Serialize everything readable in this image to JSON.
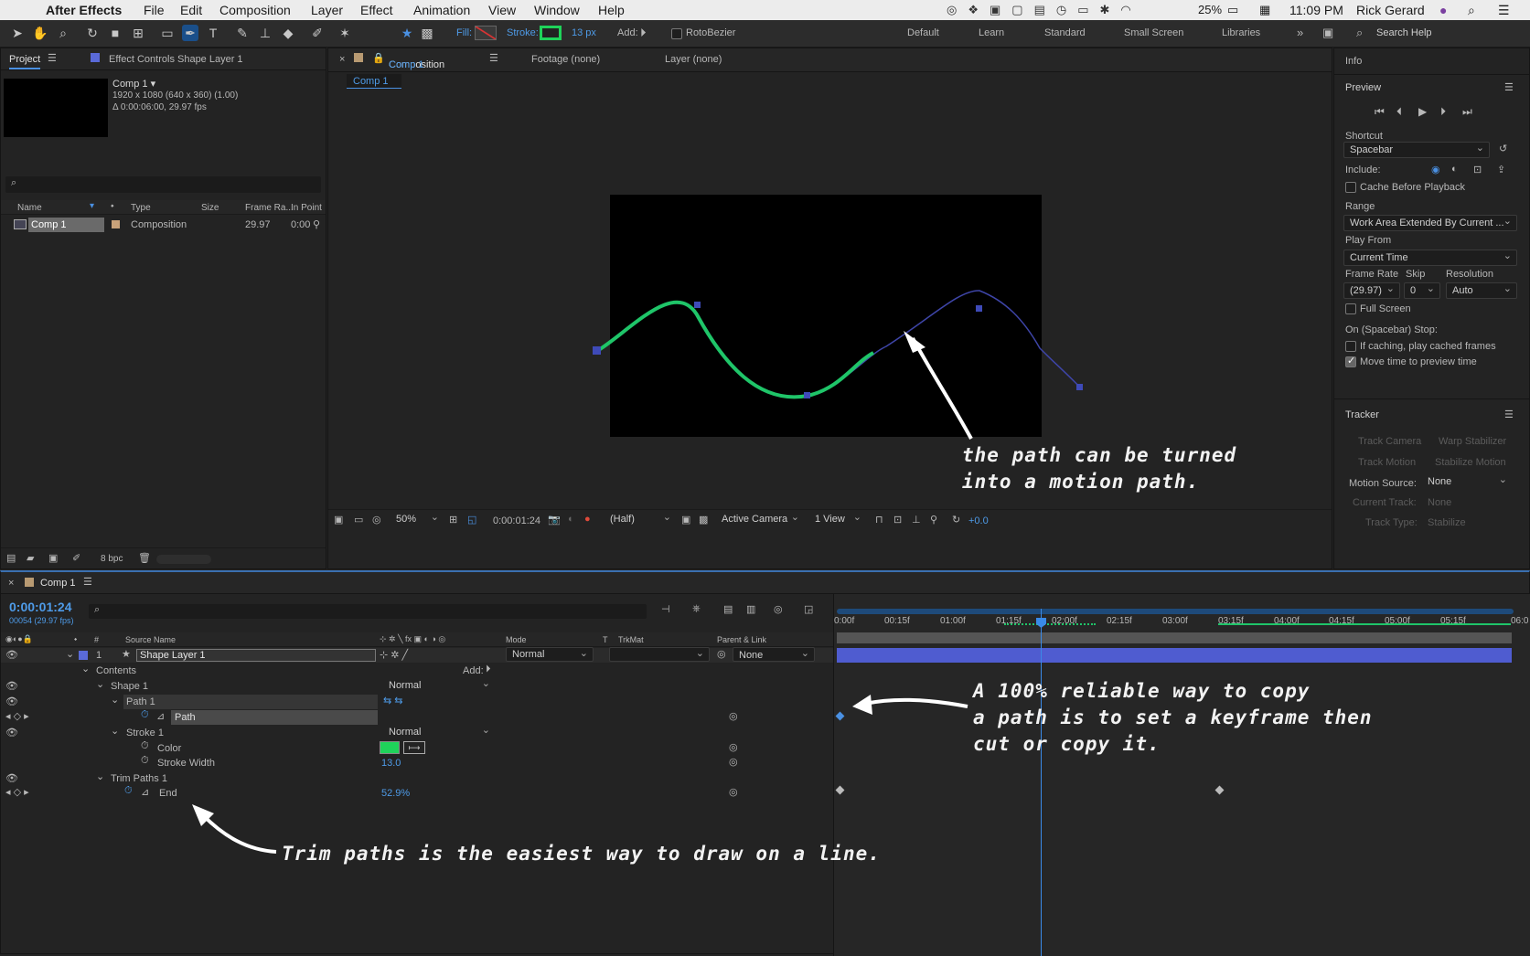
{
  "menubar": {
    "app": "After Effects",
    "items": [
      "File",
      "Edit",
      "Composition",
      "Layer",
      "Effect",
      "Animation",
      "View",
      "Window",
      "Help"
    ],
    "battery": "25%",
    "time": "11:09 PM",
    "user": "Rick Gerard"
  },
  "toolbar": {
    "fill_label": "Fill:",
    "stroke_label": "Stroke:",
    "stroke_width": "13 px",
    "add_label": "Add:",
    "rotobezier": "RotoBezier",
    "workspaces": [
      "Default",
      "Learn",
      "Standard",
      "Small Screen",
      "Libraries"
    ],
    "search_help": "Search Help",
    "stroke_color": "#1fd35a"
  },
  "project": {
    "tab": "Project",
    "effect_controls": "Effect Controls Shape Layer 1",
    "comp_name": "Comp 1 ▾",
    "comp_size": "1920 x 1080  (640 x 360) (1.00)",
    "comp_duration": "Δ 0:00:06:00, 29.97 fps",
    "columns": [
      "Name",
      "Type",
      "Size",
      "Frame Ra...",
      "In Point"
    ],
    "row": {
      "name": "Comp 1",
      "type": "Composition",
      "fps": "29.97",
      "in": "0:00"
    },
    "bpc": "8 bpc"
  },
  "viewer": {
    "tab_comp_prefix": "Composition",
    "tab_comp_name": "Comp 1",
    "tab_footage": "Footage (none)",
    "tab_layer": "Layer (none)",
    "subtab": "Comp 1",
    "zoom": "50%",
    "timecode": "0:00:01:24",
    "resolution": "(Half)",
    "camera": "Active Camera",
    "views": "1 View",
    "exposure": "+0.0"
  },
  "info_panel": {
    "info": "Info",
    "preview": "Preview",
    "shortcut_label": "Shortcut",
    "shortcut": "Spacebar",
    "include": "Include:",
    "cache_before": "Cache Before Playback",
    "range_label": "Range",
    "range": "Work Area Extended By Current ...",
    "play_from_label": "Play From",
    "play_from": "Current Time",
    "frame_rate_label": "Frame Rate",
    "skip_label": "Skip",
    "resolution_label": "Resolution",
    "frame_rate": "(29.97)",
    "skip": "0",
    "resolution": "Auto",
    "full_screen": "Full Screen",
    "on_stop": "On (Spacebar) Stop:",
    "if_caching": "If caching, play cached frames",
    "move_time": "Move time to preview time",
    "tracker": "Tracker",
    "track_camera": "Track Camera",
    "warp_stabilizer": "Warp Stabilizer",
    "track_motion": "Track Motion",
    "stabilize_motion": "Stabilize Motion",
    "motion_source_label": "Motion Source:",
    "motion_source": "None",
    "current_track_label": "Current Track:",
    "current_track": "None",
    "track_type_label": "Track Type:",
    "track_type": "Stabilize"
  },
  "timeline": {
    "tab": "Comp 1",
    "timecode": "0:00:01:24",
    "frames": "00054 (29.97 fps)",
    "col_source": "Source Name",
    "col_mode": "Mode",
    "col_t": "T",
    "col_trkmat": "TrkMat",
    "col_parent": "Parent & Link",
    "layer_num": "1",
    "layer_name": "Shape Layer 1",
    "layer_mode": "Normal",
    "layer_parent": "None",
    "contents": "Contents",
    "add": "Add:",
    "shape1": "Shape 1",
    "shape1_mode": "Normal",
    "path1": "Path 1",
    "path": "Path",
    "stroke1": "Stroke 1",
    "stroke1_mode": "Normal",
    "color": "Color",
    "stroke_width": "Stroke Width",
    "stroke_width_val": "13.0",
    "trim": "Trim Paths 1",
    "end": "End",
    "end_val": "52.9%",
    "ruler": [
      "0:00f",
      "00:15f",
      "01:00f",
      "01:15f",
      "02:00f",
      "02:15f",
      "03:00f",
      "03:15f",
      "04:00f",
      "04:15f",
      "05:00f",
      "05:15f",
      "06:0"
    ]
  },
  "annotations": {
    "motion_path": [
      "the path can be turned",
      "into a motion path."
    ],
    "keyframe": [
      "A 100% reliable way to copy",
      "a path is to set a keyframe then",
      "cut or copy it."
    ],
    "trim": "Trim paths is the easiest way to draw on a line."
  }
}
